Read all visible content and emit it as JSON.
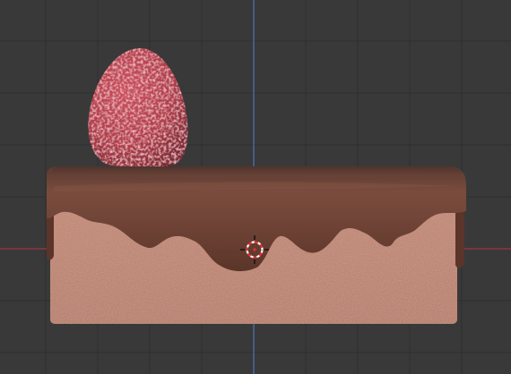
{
  "viewport": {
    "background": "#393939",
    "grid_major_color": "#2e2e2e",
    "grid_minor_color": "#353535",
    "axis_y_color": "#4f74b8",
    "axis_x_color": "#a0343f"
  },
  "scene": {
    "objects": [
      {
        "name": "strawberry",
        "color": "#b5424f"
      },
      {
        "name": "cake-sponge",
        "color": "#c08472"
      },
      {
        "name": "chocolate-icing",
        "color": "#6e4336"
      }
    ]
  },
  "cursor": {
    "icon": "3d-cursor-icon",
    "ring_color_a": "#ffffff",
    "ring_color_b": "#e0313a"
  }
}
